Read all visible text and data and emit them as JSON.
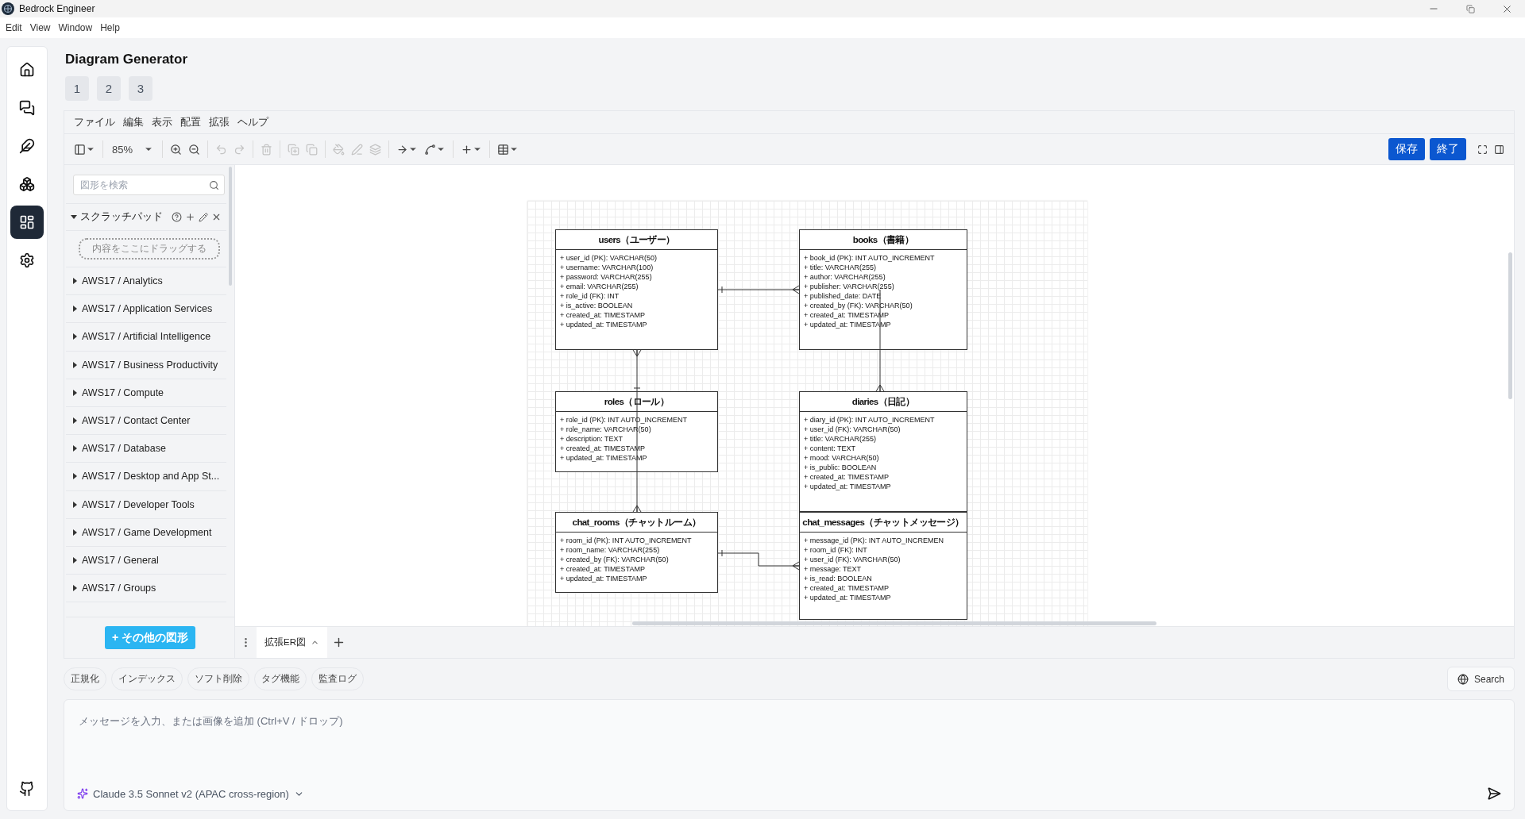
{
  "window": {
    "title": "Bedrock Engineer"
  },
  "menu": [
    "Edit",
    "View",
    "Window",
    "Help"
  ],
  "nav": [
    {
      "kind": "home",
      "selected": false
    },
    {
      "kind": "chat",
      "selected": false
    },
    {
      "kind": "feather",
      "selected": false
    },
    {
      "kind": "agents",
      "selected": false
    },
    {
      "kind": "diagram",
      "selected": true
    },
    {
      "kind": "settings",
      "selected": false
    }
  ],
  "page": {
    "title": "Diagram Generator",
    "tabs": [
      "1",
      "2",
      "3"
    ]
  },
  "editor": {
    "menu": [
      "ファイル",
      "編集",
      "表示",
      "配置",
      "拡張",
      "ヘルプ"
    ],
    "zoom": "85%",
    "toolbar": [
      {
        "kind": "panel",
        "disabled": false
      },
      {
        "kind": "zoom-in",
        "disabled": false
      },
      {
        "kind": "zoom-out",
        "disabled": false
      },
      {
        "kind": "undo",
        "disabled": true
      },
      {
        "kind": "redo",
        "disabled": true
      },
      {
        "kind": "delete",
        "disabled": true
      },
      {
        "kind": "front",
        "disabled": true
      },
      {
        "kind": "back",
        "disabled": true
      },
      {
        "kind": "fill",
        "disabled": true
      },
      {
        "kind": "line",
        "disabled": true
      },
      {
        "kind": "shadow",
        "disabled": true
      },
      {
        "kind": "connection",
        "disabled": false
      },
      {
        "kind": "waypoint",
        "disabled": false
      },
      {
        "kind": "insert",
        "disabled": false
      },
      {
        "kind": "table",
        "disabled": false
      }
    ],
    "actions": [
      "保存",
      "終了"
    ],
    "sidebar": {
      "search_placeholder": "図形を検索",
      "scratchpad": {
        "title": "スクラッチパッド",
        "expanded": true,
        "dropzone": "内容をここにドラッグする"
      },
      "libraries": [
        "AWS17 / Analytics",
        "AWS17 / Application Services",
        "AWS17 / Artificial Intelligence",
        "AWS17 / Business Productivity",
        "AWS17 / Compute",
        "AWS17 / Contact Center",
        "AWS17 / Database",
        "AWS17 / Desktop and App St...",
        "AWS17 / Developer Tools",
        "AWS17 / Game Development",
        "AWS17 / General",
        "AWS17 / Groups"
      ],
      "more_button": "+ その他の図形"
    },
    "diagram": {
      "tables": [
        {
          "name": "users（ユーザー）",
          "fields": [
            "+ user_id (PK): VARCHAR(50)",
            "+ username: VARCHAR(100)",
            "+ password: VARCHAR(255)",
            "+ email: VARCHAR(255)",
            "+ role_id (FK): INT",
            "+ is_active: BOOLEAN",
            "+ created_at: TIMESTAMP",
            "+ updated_at: TIMESTAMP"
          ]
        },
        {
          "name": "books（書籍）",
          "fields": [
            "+ book_id (PK): INT AUTO_INCREMENT",
            "+ title: VARCHAR(255)",
            "+ author: VARCHAR(255)",
            "+ publisher: VARCHAR(255)",
            "+ published_date: DATE",
            "+ created_by (FK): VARCHAR(50)",
            "+ created_at: TIMESTAMP",
            "+ updated_at: TIMESTAMP"
          ]
        },
        {
          "name": "roles（ロール）",
          "fields": [
            "+ role_id (PK): INT AUTO_INCREMENT",
            "+ role_name: VARCHAR(50)",
            "+ description: TEXT",
            "+ created_at: TIMESTAMP",
            "+ updated_at: TIMESTAMP"
          ]
        },
        {
          "name": "diaries（日記）",
          "fields": [
            "+ diary_id (PK): INT AUTO_INCREMENT",
            "+ user_id (FK): VARCHAR(50)",
            "+ title: VARCHAR(255)",
            "+ content: TEXT",
            "+ mood: VARCHAR(50)",
            "+ is_public: BOOLEAN",
            "+ created_at: TIMESTAMP",
            "+ updated_at: TIMESTAMP"
          ]
        },
        {
          "name": "chat_rooms（チャットルーム）",
          "fields": [
            "+ room_id (PK): INT AUTO_INCREMENT",
            "+ room_name: VARCHAR(255)",
            "+ created_by (FK): VARCHAR(50)",
            "+ created_at: TIMESTAMP",
            "+ updated_at: TIMESTAMP"
          ]
        },
        {
          "name": "chat_messages（チャットメッセージ）",
          "fields": [
            "+ message_id (PK): INT AUTO_INCREMEN",
            "+ room_id (FK): INT",
            "+ user_id (FK): VARCHAR(50)",
            "+ message: TEXT",
            "+ is_read: BOOLEAN",
            "+ created_at: TIMESTAMP",
            "+ updated_at: TIMESTAMP"
          ]
        }
      ]
    },
    "page_tab": "拡張ER図"
  },
  "chips": [
    "正規化",
    "インデックス",
    "ソフト削除",
    "タグ機能",
    "監査ログ"
  ],
  "search_button": "Search",
  "chat": {
    "placeholder": "メッセージを入力、または画像を追加 (Ctrl+V / ドロップ)",
    "model": "Claude 3.5 Sonnet v2 (APAC cross-region)"
  }
}
